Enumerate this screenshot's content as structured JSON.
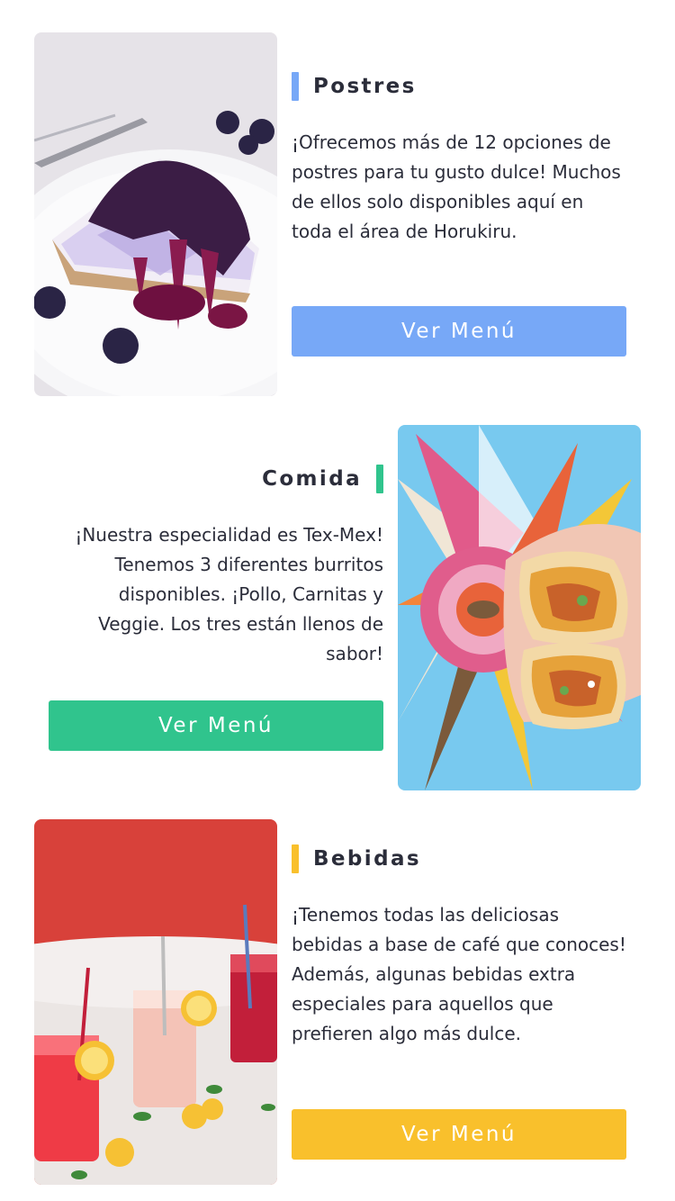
{
  "sections": [
    {
      "title": "Postres",
      "description": "¡Ofrecemos más de 12 opciones de postres para tu gusto dulce! Muchos de ellos solo disponibles aquí en toda el área de Horukiru.",
      "button_label": "Ver Menú",
      "accent_color": "#77a8f7",
      "image": "blueberry-cheesecake-photo"
    },
    {
      "title": "Comida",
      "description": "¡Nuestra especialidad es Tex-Mex! Tenemos 3 diferentes burritos disponibles. ¡Pollo, Carnitas y Veggie. Los tres están llenos de sabor!",
      "button_label": "Ver Menú",
      "accent_color": "#30c48d",
      "image": "burrito-mural-photo"
    },
    {
      "title": "Bebidas",
      "description": "¡Tenemos todas las deliciosas bebidas a base de café que conoces! Además, algunas bebidas extra especiales para aquellos que prefieren algo más dulce.",
      "button_label": "Ver Menú",
      "accent_color": "#f9c02c",
      "image": "lemonade-drinks-photo"
    }
  ]
}
